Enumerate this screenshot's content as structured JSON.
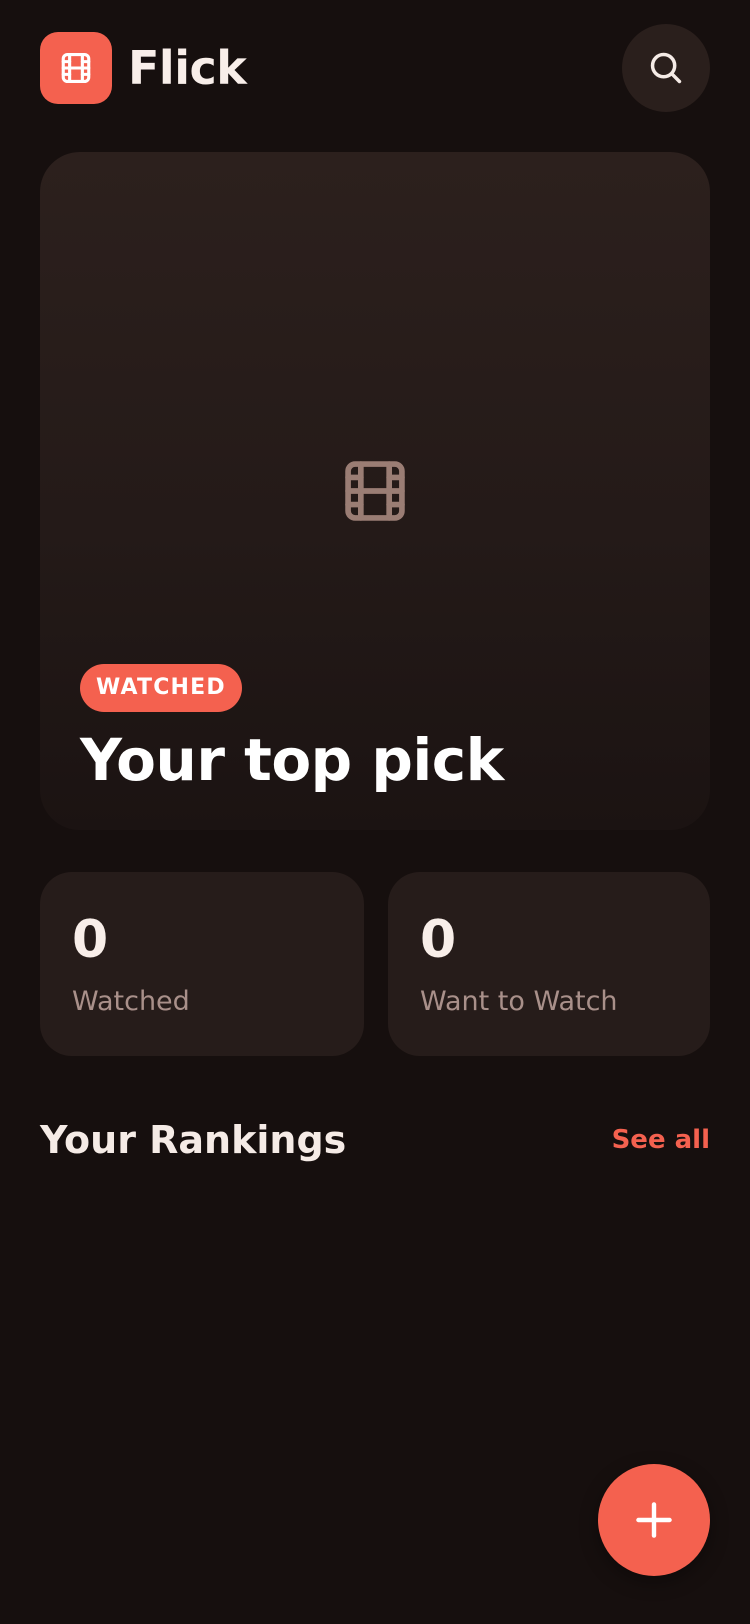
{
  "header": {
    "app_name": "Flick",
    "logo_icon": "film-icon",
    "search_icon": "search-icon"
  },
  "hero": {
    "placeholder_icon": "film-icon",
    "badge": "WATCHED",
    "title": "Your top pick"
  },
  "stats": [
    {
      "value": "0",
      "label": "Watched"
    },
    {
      "value": "0",
      "label": "Want to Watch"
    }
  ],
  "rankings": {
    "title": "Your Rankings",
    "see_all": "See all"
  },
  "fab": {
    "icon": "plus-icon"
  },
  "colors": {
    "accent": "#f4614f",
    "background": "#160f0e",
    "card": "#261c1a"
  }
}
